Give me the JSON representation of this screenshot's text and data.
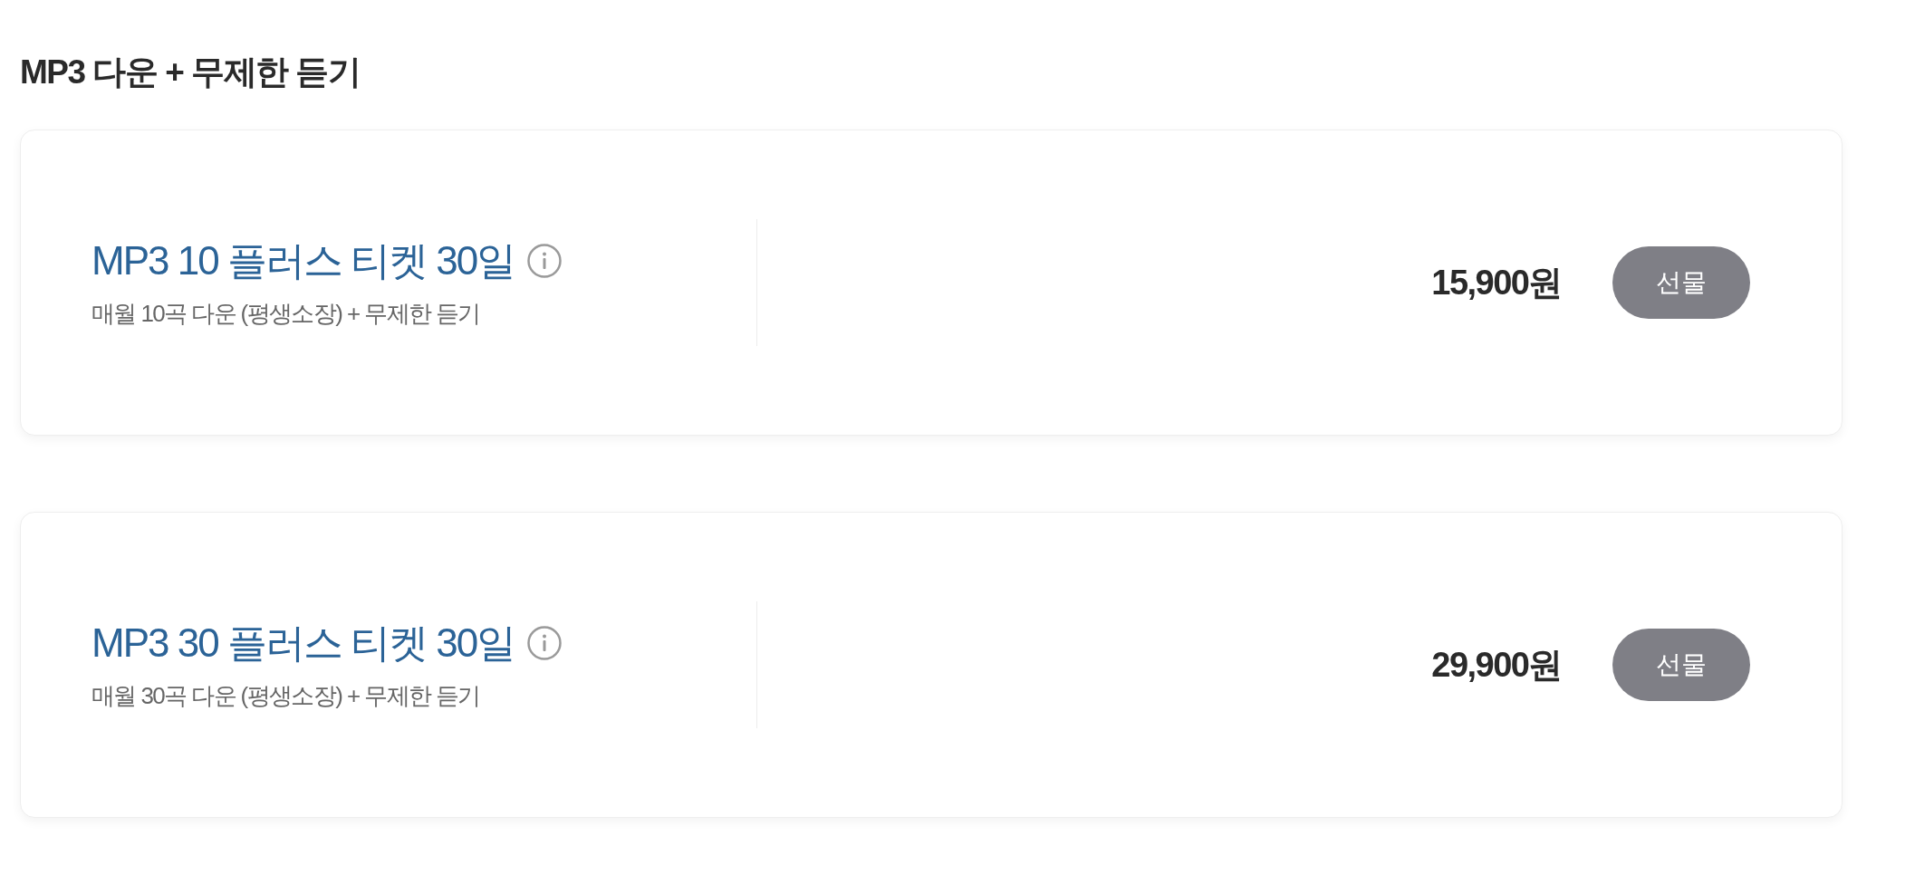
{
  "section": {
    "title": "MP3 다운 + 무제한 듣기"
  },
  "tickets": [
    {
      "name": "MP3 10 플러스 티켓 30일",
      "description": "매월 10곡 다운 (평생소장) + 무제한 듣기",
      "price": "15,900원",
      "button": "선물"
    },
    {
      "name": "MP3 30 플러스 티켓 30일",
      "description": "매월 30곡 다운 (평생소장) + 무제한 듣기",
      "price": "29,900원",
      "button": "선물"
    }
  ]
}
